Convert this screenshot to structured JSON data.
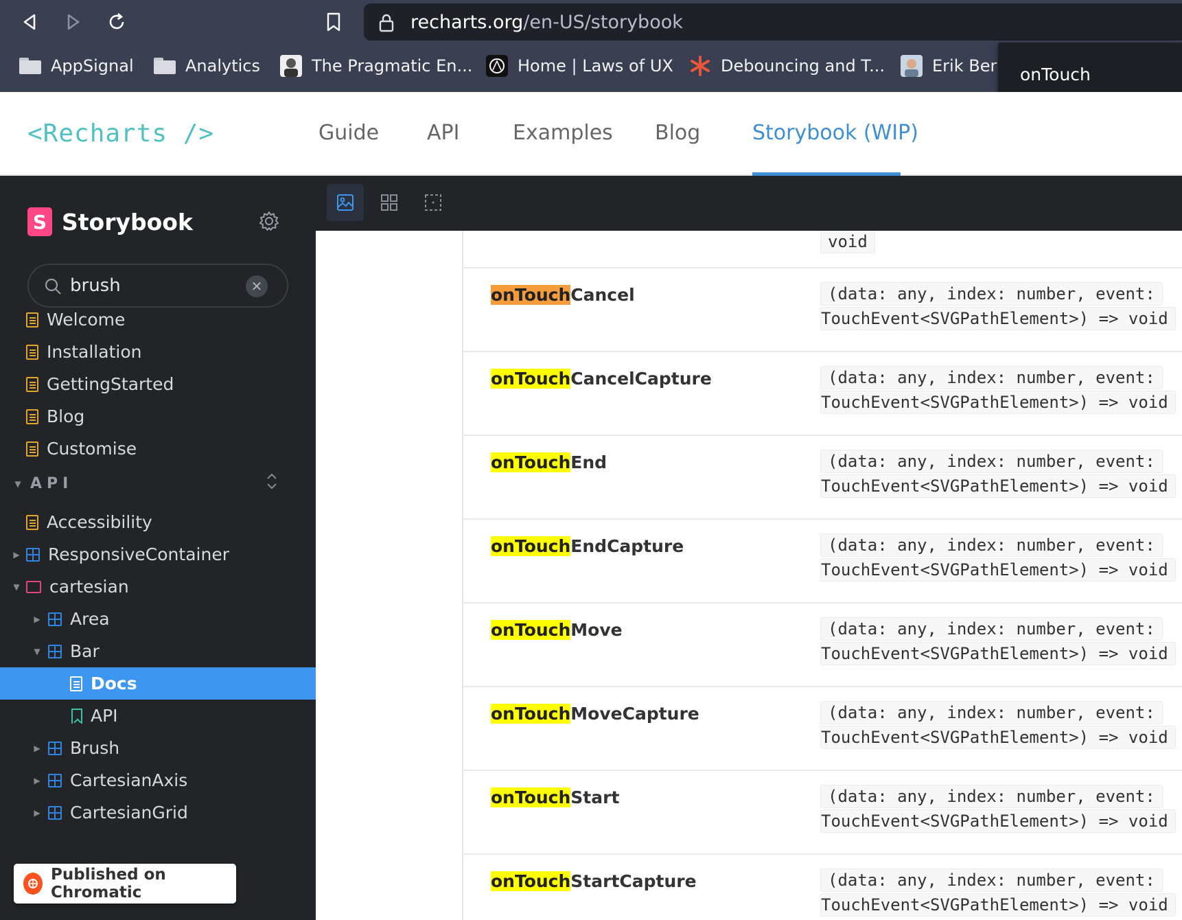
{
  "browser": {
    "url_host": "recharts.org",
    "url_path": "/en-US/storybook",
    "bookmarks": [
      {
        "label": "AppSignal",
        "icon": "folder-icon"
      },
      {
        "label": "Analytics",
        "icon": "folder-icon"
      },
      {
        "label": "The Pragmatic En...",
        "icon": "avatar-favicon"
      },
      {
        "label": "Home | Laws of UX",
        "icon": "laws-of-ux-favicon"
      },
      {
        "label": "Debouncing and T...",
        "icon": "asterisk-favicon"
      },
      {
        "label": "Erik Berr",
        "icon": "avatar-favicon"
      }
    ],
    "tooltip": "onTouch"
  },
  "site": {
    "logo": "<Recharts />",
    "nav": [
      {
        "label": "Guide"
      },
      {
        "label": "API"
      },
      {
        "label": "Examples"
      },
      {
        "label": "Blog"
      },
      {
        "label": "Storybook (WIP)",
        "active": true
      }
    ],
    "accent": "#3f8fd4"
  },
  "storybook": {
    "brand": "Storybook",
    "search_value": "brush",
    "top_items": [
      "Welcome",
      "Installation",
      "GettingStarted",
      "Blog",
      "Customise"
    ],
    "api_section": "API",
    "api_items": [
      {
        "label": "Accessibility",
        "icon": "doc-icon",
        "caret": ""
      },
      {
        "label": "ResponsiveContainer",
        "icon": "component-icon",
        "caret": "right"
      },
      {
        "label": "cartesian",
        "icon": "folder-icon",
        "caret": "down"
      },
      {
        "label": "Area",
        "icon": "component-icon",
        "caret": "right"
      },
      {
        "label": "Bar",
        "icon": "component-icon",
        "caret": "down"
      },
      {
        "label": "Docs",
        "icon": "doc-icon",
        "caret": "",
        "selected": true
      },
      {
        "label": "API",
        "icon": "bookmark-icon",
        "caret": ""
      },
      {
        "label": "Brush",
        "icon": "component-icon",
        "caret": "right"
      },
      {
        "label": "CartesianAxis",
        "icon": "component-icon",
        "caret": "right"
      },
      {
        "label": "CartesianGrid",
        "icon": "component-icon",
        "caret": "right"
      }
    ],
    "chromatic_badge": "Published on Chromatic",
    "selected_color": "#3d97f0"
  },
  "props_table": {
    "top_partial_type": "void",
    "highlight_term": "onTouch",
    "rows": [
      {
        "match": "onTouch",
        "rest": "Cancel",
        "current": true,
        "type_line1": "(data: any, index: number, event:",
        "type_line2": "TouchEvent<SVGPathElement>) => void"
      },
      {
        "match": "onTouch",
        "rest": "CancelCapture",
        "type_line1": "(data: any, index: number, event:",
        "type_line2": "TouchEvent<SVGPathElement>) => void"
      },
      {
        "match": "onTouch",
        "rest": "End",
        "type_line1": "(data: any, index: number, event:",
        "type_line2": "TouchEvent<SVGPathElement>) => void"
      },
      {
        "match": "onTouch",
        "rest": "EndCapture",
        "type_line1": "(data: any, index: number, event:",
        "type_line2": "TouchEvent<SVGPathElement>) => void"
      },
      {
        "match": "onTouch",
        "rest": "Move",
        "type_line1": "(data: any, index: number, event:",
        "type_line2": "TouchEvent<SVGPathElement>) => void"
      },
      {
        "match": "onTouch",
        "rest": "MoveCapture",
        "type_line1": "(data: any, index: number, event:",
        "type_line2": "TouchEvent<SVGPathElement>) => void"
      },
      {
        "match": "onTouch",
        "rest": "Start",
        "type_line1": "(data: any, index: number, event:",
        "type_line2": "TouchEvent<SVGPathElement>) => void"
      },
      {
        "match": "onTouch",
        "rest": "StartCapture",
        "type_line1": "(data: any, index: number, event:",
        "type_line2": "TouchEvent<SVGPathElement>) => void"
      }
    ]
  }
}
